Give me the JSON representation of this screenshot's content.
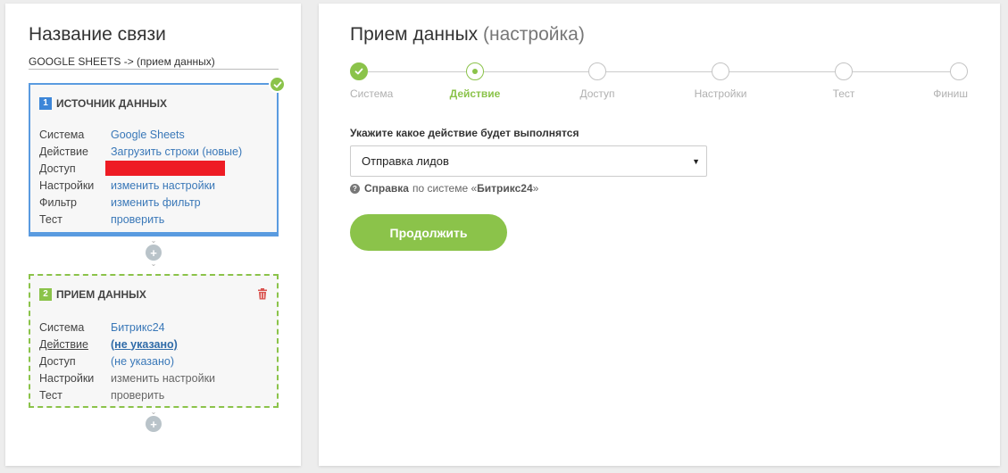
{
  "left_panel": {
    "title": "Название связи",
    "connection_name": "GOOGLE SHEETS -> (прием данных)",
    "card1": {
      "number": "1",
      "title": "ИСТОЧНИК ДАННЫХ",
      "rows": [
        {
          "key": "Система",
          "value": "Google Sheets"
        },
        {
          "key": "Действие",
          "value": "Загрузить строки (новые)"
        },
        {
          "key": "Доступ",
          "value": ""
        },
        {
          "key": "Настройки",
          "value": "изменить настройки"
        },
        {
          "key": "Фильтр",
          "value": "изменить фильтр"
        },
        {
          "key": "Тест",
          "value": "проверить"
        }
      ]
    },
    "card2": {
      "number": "2",
      "title": "ПРИЕМ ДАННЫХ",
      "rows": [
        {
          "key": "Система",
          "value": "Битрикс24"
        },
        {
          "key": "Действие",
          "value": "(не указано)"
        },
        {
          "key": "Доступ",
          "value": "(не указано)"
        },
        {
          "key": "Настройки",
          "value": "изменить настройки"
        },
        {
          "key": "Тест",
          "value": "проверить"
        }
      ]
    },
    "plus_glyph": "+"
  },
  "right_panel": {
    "title": "Прием данных",
    "subtitle": "(настройка)",
    "steps": [
      {
        "label": "Система",
        "state": "done"
      },
      {
        "label": "Действие",
        "state": "active"
      },
      {
        "label": "Доступ",
        "state": "pending"
      },
      {
        "label": "Настройки",
        "state": "pending"
      },
      {
        "label": "Тест",
        "state": "pending"
      },
      {
        "label": "Финиш",
        "state": "pending"
      }
    ],
    "field_label": "Укажите какое действие будет выполнятся",
    "select_value": "Отправка лидов",
    "help": {
      "icon_glyph": "?",
      "bold": "Справка",
      "text": "по системе «",
      "system": "Битрикс24",
      "close": "»"
    },
    "continue_button": "Продолжить"
  },
  "colors": {
    "accent_green": "#8bc34a",
    "accent_blue": "#3d86d8",
    "link_blue": "#3a78b8",
    "redaction": "#ee1c24",
    "background": "#ededed"
  },
  "icons": {
    "card1_badge": "check-icon",
    "card2_action": "trash-icon",
    "select": "caret-down-icon",
    "help": "question-circle-icon"
  }
}
